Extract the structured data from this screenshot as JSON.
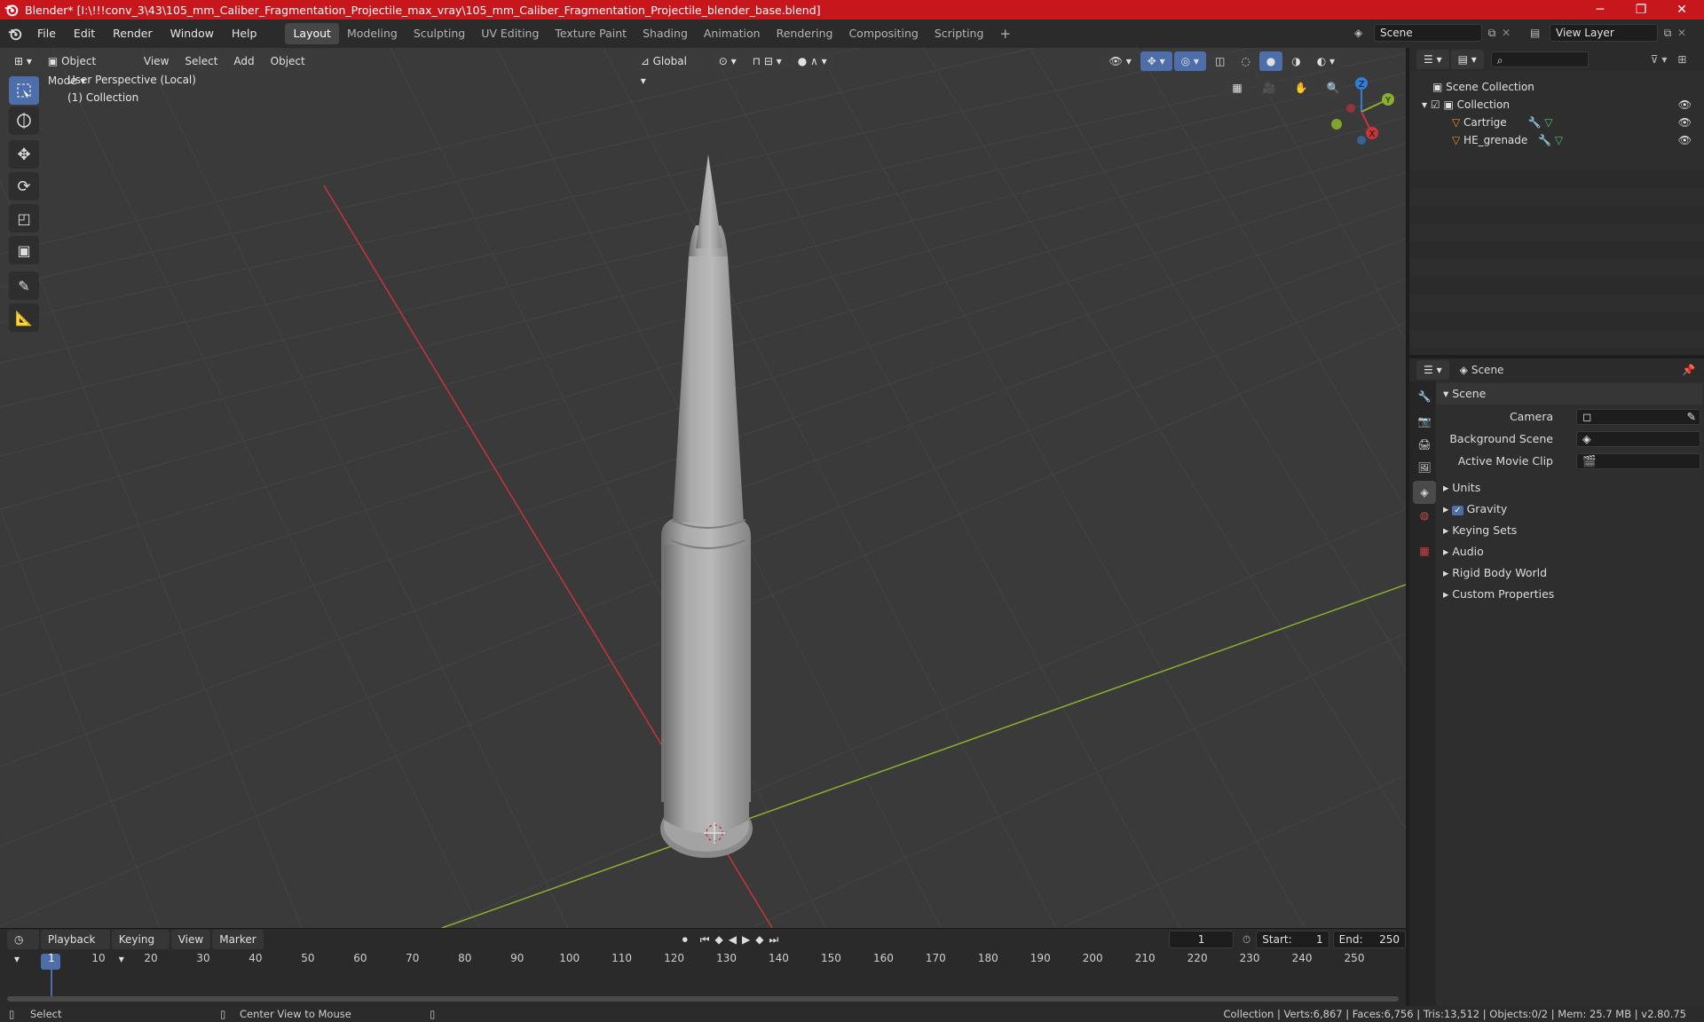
{
  "window": {
    "title": "Blender* [I:\\!!!conv_3\\43\\105_mm_Caliber_Fragmentation_Projectile_max_vray\\105_mm_Caliber_Fragmentation_Projectile_blender_base.blend]",
    "minimize": "─",
    "maximize": "❐",
    "close": "✕"
  },
  "menus": [
    "File",
    "Edit",
    "Render",
    "Window",
    "Help"
  ],
  "workspaces": [
    "Layout",
    "Modeling",
    "Sculpting",
    "UV Editing",
    "Texture Paint",
    "Shading",
    "Animation",
    "Rendering",
    "Compositing",
    "Scripting"
  ],
  "active_workspace": "Layout",
  "add_tab": "+",
  "scene_field": "Scene",
  "view_layer_field": "View Layer",
  "viewport": {
    "mode": "Object Mode",
    "menus": [
      "View",
      "Select",
      "Add",
      "Object"
    ],
    "orientation": "Global",
    "overlay_line1": "User Perspective (Local)",
    "overlay_line2": "(1) Collection",
    "gizmo": {
      "x": "X",
      "y": "Y",
      "z": "Z"
    }
  },
  "outliner": {
    "root": "Scene Collection",
    "collection": "Collection",
    "objects": [
      "Cartrige",
      "HE_grenade"
    ]
  },
  "properties": {
    "header": "Scene",
    "panel": "Scene",
    "camera_label": "Camera",
    "background_label": "Background Scene",
    "movieclip_label": "Active Movie Clip",
    "sections": [
      "Units",
      "Gravity",
      "Keying Sets",
      "Audio",
      "Rigid Body World",
      "Custom Properties"
    ]
  },
  "timeline": {
    "menus": [
      "Playback",
      "Keying",
      "View",
      "Marker"
    ],
    "current_frame": "1",
    "start_label": "Start:",
    "start": "1",
    "end_label": "End:",
    "end": "250",
    "ticks": [
      "1",
      "10",
      "20",
      "30",
      "40",
      "50",
      "60",
      "70",
      "80",
      "90",
      "100",
      "110",
      "120",
      "130",
      "140",
      "150",
      "160",
      "170",
      "180",
      "190",
      "200",
      "210",
      "220",
      "230",
      "240",
      "250"
    ]
  },
  "status": {
    "select": "Select",
    "center": "Center View to Mouse",
    "stats": "Collection | Verts:6,867 | Faces:6,756 | Tris:13,512 | Objects:0/2 | Mem: 25.7 MB | v2.80.75"
  },
  "colors": {
    "titlebar": "#c8161d",
    "accent": "#4d6ea8",
    "x_axis": "#c8343c",
    "y_axis": "#8ab02c",
    "z_axis": "#2f7fd8"
  }
}
